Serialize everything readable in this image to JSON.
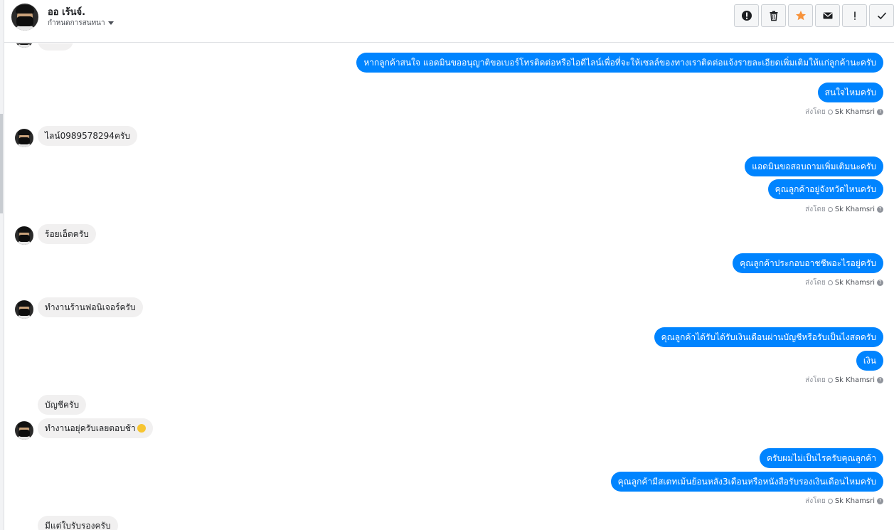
{
  "header": {
    "contact_name": "ออ เร้นจ์.",
    "assign_label": "กำหนดการสนทนา",
    "toolbar": [
      {
        "name": "mark-spam-button",
        "icon": "alert-circle-icon",
        "glyph": "!"
      },
      {
        "name": "delete-button",
        "icon": "trash-icon",
        "glyph": ""
      },
      {
        "name": "star-button",
        "icon": "star-icon",
        "glyph": "★"
      },
      {
        "name": "mark-unread-button",
        "icon": "envelope-icon",
        "glyph": ""
      },
      {
        "name": "follow-up-button",
        "icon": "exclamation-icon",
        "glyph": "!"
      },
      {
        "name": "mark-done-button",
        "icon": "check-icon",
        "glyph": "✓"
      }
    ]
  },
  "chat": {
    "sent_by_label": "ส่งโดย",
    "agent_name": "Sk Khamsri",
    "help_glyph": "?",
    "messages": [
      {
        "dir": "out",
        "text": "หากลูกค้าสนใจ แอดมินขออนุญาติขอเบอร์โทรติดต่อหรือไอดีไลน์เพื่อที่จะให้เซลล์ของทางเราติดต่อแจ้งรายละเอียดเพิ่มเติมให้แก่ลูกค้านะครับ"
      },
      {
        "dir": "out",
        "text": "สนใจไหมครับ"
      },
      {
        "dir": "in",
        "text": "ไลน์0989578294ครับ"
      },
      {
        "dir": "out",
        "text": "แอดมินขอสอบถามเพิ่มเติมนะครับ"
      },
      {
        "dir": "out",
        "text": "คุณลูกค้าอยู่จังหวัดไหนครับ"
      },
      {
        "dir": "in",
        "text": "ร้อยเอ็ดครับ"
      },
      {
        "dir": "out",
        "text": "คุณลูกค้าประกอบอาชชีพอะไรอยู่ครับ"
      },
      {
        "dir": "in",
        "text": "ทำงานร้านฟอนิเจอร์ครับ"
      },
      {
        "dir": "out",
        "text": "คุณลูกค้าได้รับได้รับเงินเดือนผ่านบัญชีหรือรับเป็นไงสดครับ"
      },
      {
        "dir": "out",
        "text": "เงิน"
      },
      {
        "dir": "in",
        "text": "บัญชีครับ"
      },
      {
        "dir": "in",
        "text": "ทำงานอยุ่ครับเลยตอบช้า"
      },
      {
        "dir": "out",
        "text": "ครับผมไม่เป็นไรครับคุณลูกค้า"
      },
      {
        "dir": "out",
        "text": "คุณลูกค้ามีสเตทเม้นย้อนหลัง3เดือนหรือหนังสือรับรองเงินเดือนไหมครับ"
      },
      {
        "dir": "in",
        "text": "มีแต่ใบรับรองครับ"
      }
    ]
  }
}
